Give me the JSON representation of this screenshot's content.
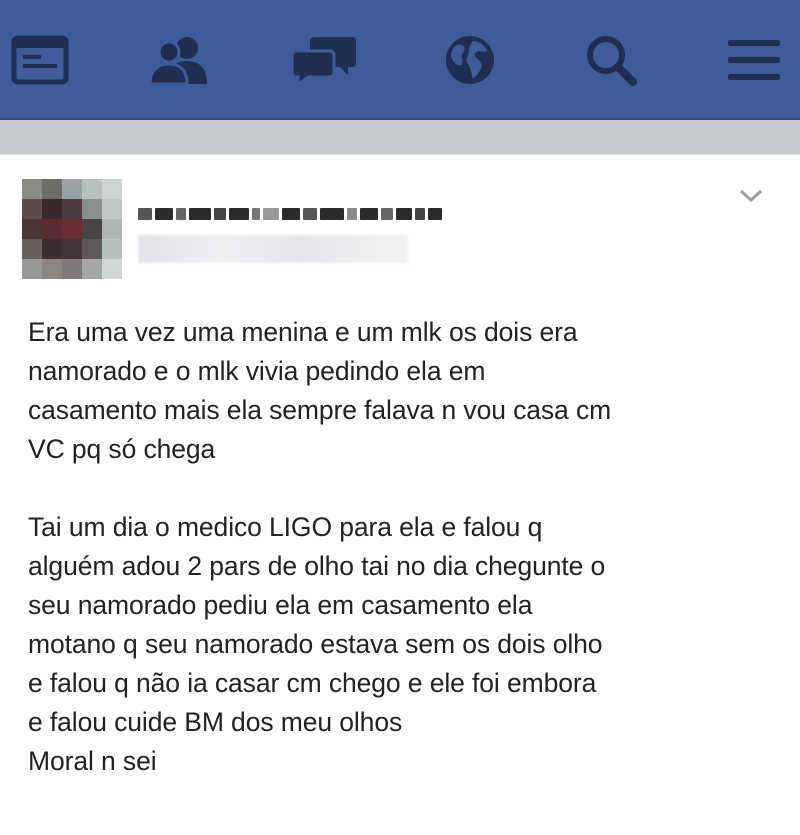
{
  "colors": {
    "topbar": "#3f5c9a",
    "icon": "#1f2f52",
    "text": "#222222"
  },
  "topbar": {
    "icons": [
      "news-feed-icon",
      "friends-icon",
      "messages-icon",
      "globe-icon",
      "search-icon",
      "menu-icon"
    ]
  },
  "post": {
    "author_name": "",
    "post_meta": "",
    "paragraph1": "Era uma vez uma menina e um mlk os dois era\nnamorado e o mlk vivia pedindo ela em\ncasamento mais ela sempre falava n vou casa cm\nVC pq só chega",
    "paragraph2": "Tai um dia o medico LIGO para ela e falou q\nalguém adou 2 pars de olho tai no dia chegunte o\nseu namorado pediu ela em casamento ela\nmotano q seu namorado estava sem os dois olho\ne falou q não ia casar cm chego e ele foi embora\ne falou cuide BM dos meu olhos\nMoral n sei"
  }
}
